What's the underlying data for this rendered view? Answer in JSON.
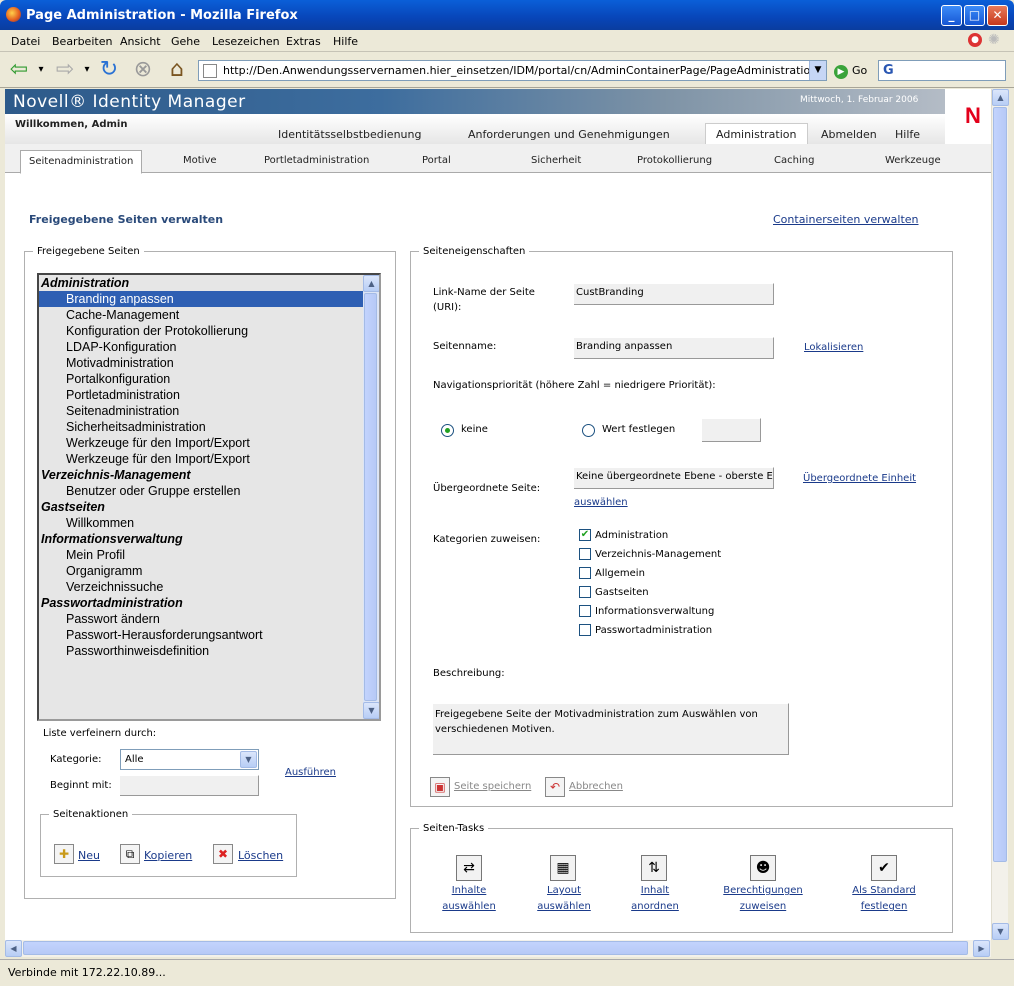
{
  "window": {
    "title": "Page Administration - Mozilla Firefox"
  },
  "menu": [
    "Datei",
    "Bearbeiten",
    "Ansicht",
    "Gehe",
    "Lesezeichen",
    "Extras",
    "Hilfe"
  ],
  "navbar": {
    "url": "http://Den.Anwendungsservernamen.hier_einsetzen/IDM/portal/cn/AdminContainerPage/PageAdministration",
    "go_label": "Go"
  },
  "header": {
    "brand": "Novell® Identity Manager",
    "date": "Mittwoch, 1. Februar 2006",
    "welcome": "Willkommen, Admin",
    "logo": "N"
  },
  "main_tabs": [
    "Identitätsselbstbedienung",
    "Anforderungen und Genehmigungen",
    "Administration",
    "Abmelden",
    "Hilfe"
  ],
  "sub_tabs": [
    "Seitenadministration",
    "Motive",
    "Portletadministration",
    "Portal",
    "Sicherheit",
    "Protokollierung",
    "Caching",
    "Werkzeuge"
  ],
  "page": {
    "heading": "Freigegebene Seiten verwalten",
    "container_link": "Containerseiten verwalten"
  },
  "left_panel": {
    "legend": "Freigegebene Seiten",
    "items": [
      {
        "text": "Administration",
        "type": "cat"
      },
      {
        "text": "Branding anpassen",
        "type": "page",
        "selected": true
      },
      {
        "text": "Cache-Management",
        "type": "page"
      },
      {
        "text": "Konfiguration der Protokollierung",
        "type": "page"
      },
      {
        "text": "LDAP-Konfiguration",
        "type": "page"
      },
      {
        "text": "Motivadministration",
        "type": "page"
      },
      {
        "text": "Portalkonfiguration",
        "type": "page"
      },
      {
        "text": "Portletadministration",
        "type": "page"
      },
      {
        "text": "Seitenadministration",
        "type": "page"
      },
      {
        "text": "Sicherheitsadministration",
        "type": "page"
      },
      {
        "text": "Werkzeuge für den Import/Export",
        "type": "page"
      },
      {
        "text": "Werkzeuge für den Import/Export",
        "type": "page"
      },
      {
        "text": "Verzeichnis-Management",
        "type": "cat"
      },
      {
        "text": "Benutzer oder Gruppe erstellen",
        "type": "page"
      },
      {
        "text": "Gastseiten",
        "type": "cat"
      },
      {
        "text": "Willkommen",
        "type": "page"
      },
      {
        "text": "Informationsverwaltung",
        "type": "cat"
      },
      {
        "text": "Mein Profil",
        "type": "page"
      },
      {
        "text": "Organigramm",
        "type": "page"
      },
      {
        "text": "Verzeichnissuche",
        "type": "page"
      },
      {
        "text": "Passwortadministration",
        "type": "cat"
      },
      {
        "text": "Passwort ändern",
        "type": "page"
      },
      {
        "text": "Passwort-Herausforderungsantwort",
        "type": "page"
      },
      {
        "text": "Passworthinweisdefinition",
        "type": "page"
      }
    ],
    "refine_label": "Liste verfeinern durch:",
    "category_label": "Kategorie:",
    "category_value": "Alle",
    "begins_label": "Beginnt mit:",
    "begins_value": "",
    "run_link": "Ausführen",
    "actions_legend": "Seitenaktionen",
    "actions": [
      "Neu",
      "Kopieren",
      "Löschen"
    ]
  },
  "props": {
    "legend": "Seiteneigenschaften",
    "link_label": "Link-Name der Seite (URI):",
    "link_value": "CustBranding",
    "name_label": "Seitenname:",
    "name_value": "Branding anpassen",
    "localize_link": "Lokalisieren",
    "nav_priority_label": "Navigationspriorität (höhere Zahl = niedrigere Priorität):",
    "radio_none": "keine",
    "radio_set": "Wert festlegen",
    "priority_value": "",
    "parent_label": "Übergeordnete Seite:",
    "parent_value": "Keine übergeordnete Ebene - oberste E",
    "parent_link1": "Übergeordnete Einheit",
    "parent_link2": "auswählen",
    "categories_label": "Kategorien zuweisen:",
    "categories": [
      {
        "label": "Administration",
        "checked": true
      },
      {
        "label": "Verzeichnis-Management",
        "checked": false
      },
      {
        "label": "Allgemein",
        "checked": false
      },
      {
        "label": "Gastseiten",
        "checked": false
      },
      {
        "label": "Informationsverwaltung",
        "checked": false
      },
      {
        "label": "Passwortadministration",
        "checked": false
      }
    ],
    "description_label": "Beschreibung:",
    "description_value": "Freigegebene Seite der Motivadministration zum Auswählen von verschiedenen Motiven.",
    "save_label": "Seite speichern",
    "cancel_label": "Abbrechen"
  },
  "tasks": {
    "legend": "Seiten-Tasks",
    "items": [
      {
        "line1": "Inhalte",
        "line2": "auswählen"
      },
      {
        "line1": "Layout",
        "line2": "auswählen"
      },
      {
        "line1": "Inhalt",
        "line2": "anordnen"
      },
      {
        "line1": "Berechtigungen",
        "line2": "zuweisen"
      },
      {
        "line1": "Als Standard",
        "line2": "festlegen"
      }
    ]
  },
  "status": {
    "text": "Verbinde mit 172.22.10.89..."
  }
}
